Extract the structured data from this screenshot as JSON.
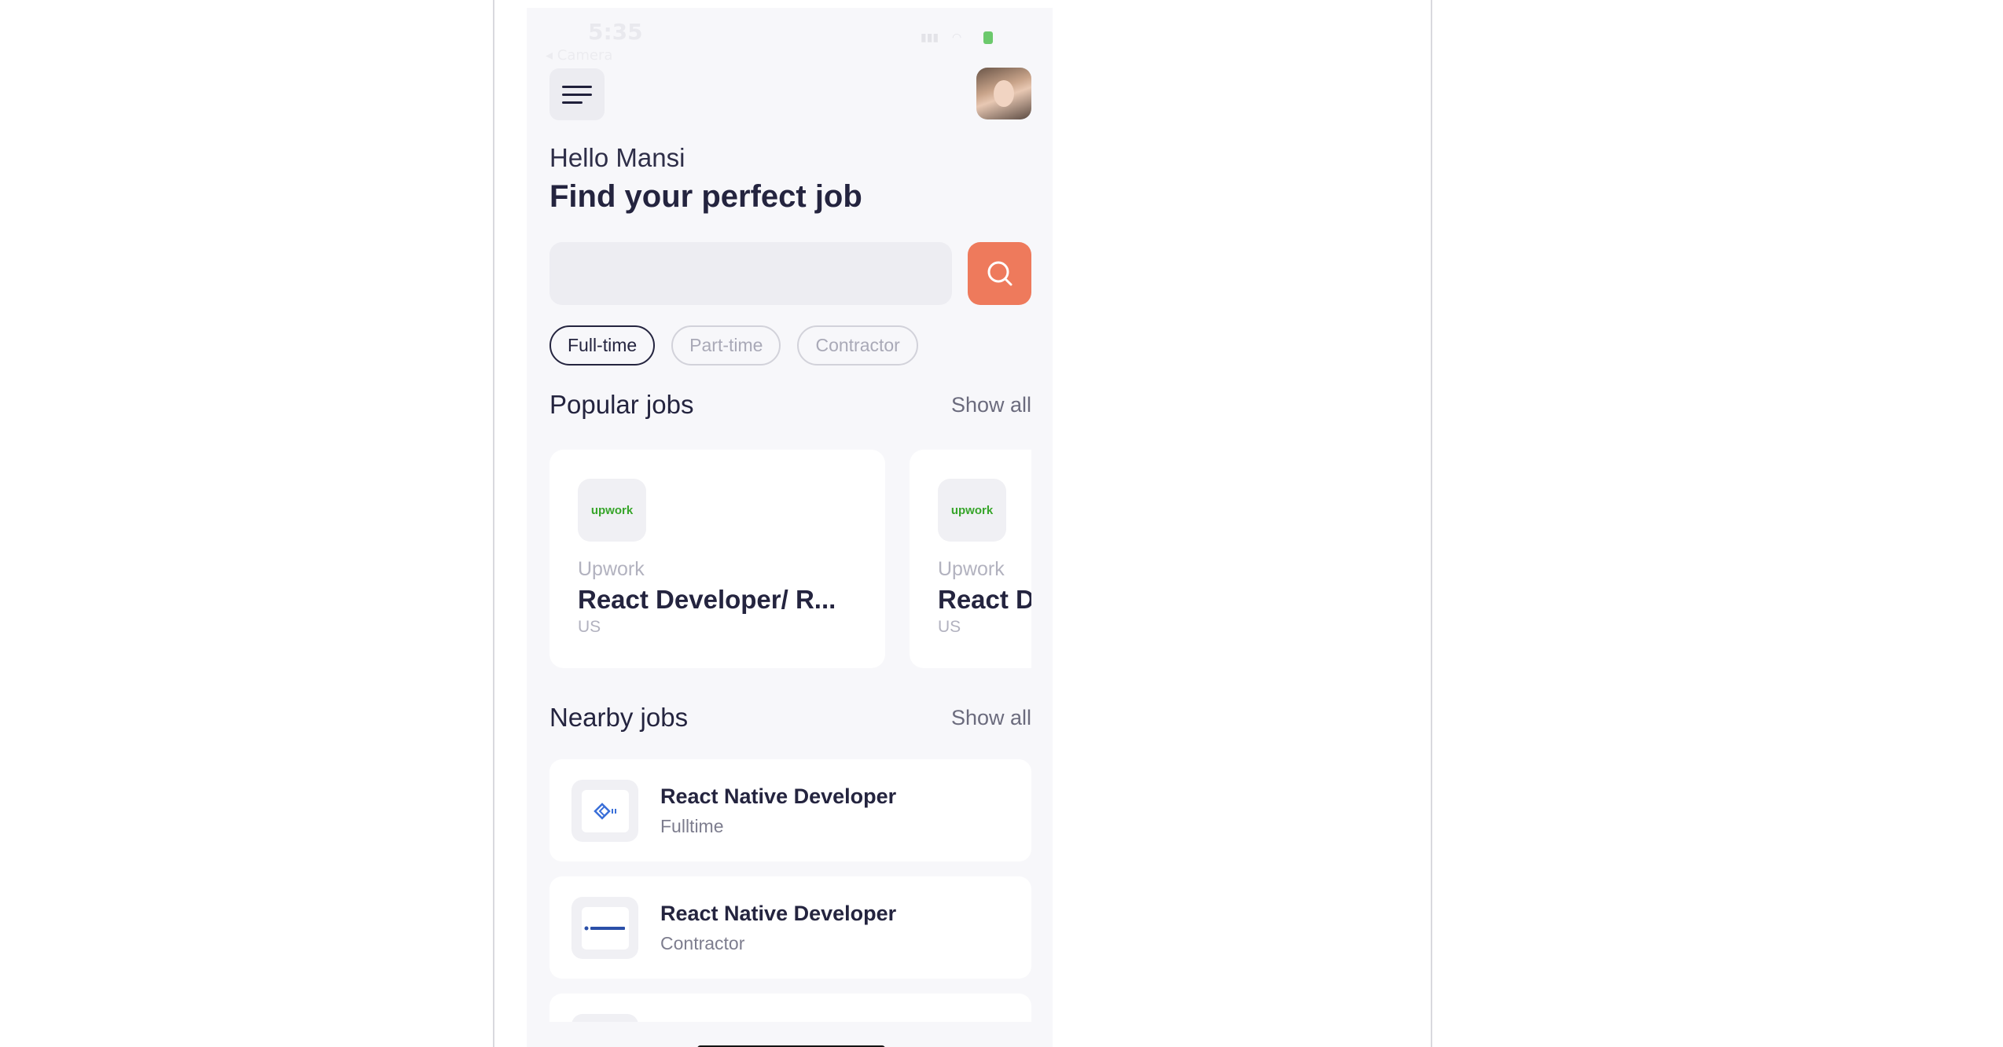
{
  "status_bar": {
    "time": "5:35",
    "back": "◂ Camera"
  },
  "header": {
    "menu_icon": "hamburger-menu-icon",
    "avatar": "user-avatar"
  },
  "greeting": "Hello Mansi",
  "headline": "Find your perfect job",
  "search": {
    "placeholder": "",
    "icon": "search-icon",
    "accent": "#ee7a5c"
  },
  "filters": [
    {
      "label": "Full-time",
      "active": true
    },
    {
      "label": "Part-time",
      "active": false
    },
    {
      "label": "Contractor",
      "active": false
    }
  ],
  "popular": {
    "title": "Popular jobs",
    "show_all": "Show all",
    "cards": [
      {
        "logo_text": "upwork",
        "company": "Upwork",
        "role": "React Developer/ R...",
        "location": "US"
      },
      {
        "logo_text": "upwork",
        "company": "Upwork",
        "role": "React D",
        "location": "US"
      }
    ]
  },
  "nearby": {
    "title": "Nearby jobs",
    "show_all": "Show all",
    "items": [
      {
        "role": "React Native Developer",
        "type": "Fulltime"
      },
      {
        "role": "React Native Developer",
        "type": "Contractor"
      }
    ]
  },
  "colors": {
    "brand": "#24243f",
    "accent": "#ee7a5c",
    "upwork": "#37a52a",
    "background": "#f7f7fa"
  }
}
